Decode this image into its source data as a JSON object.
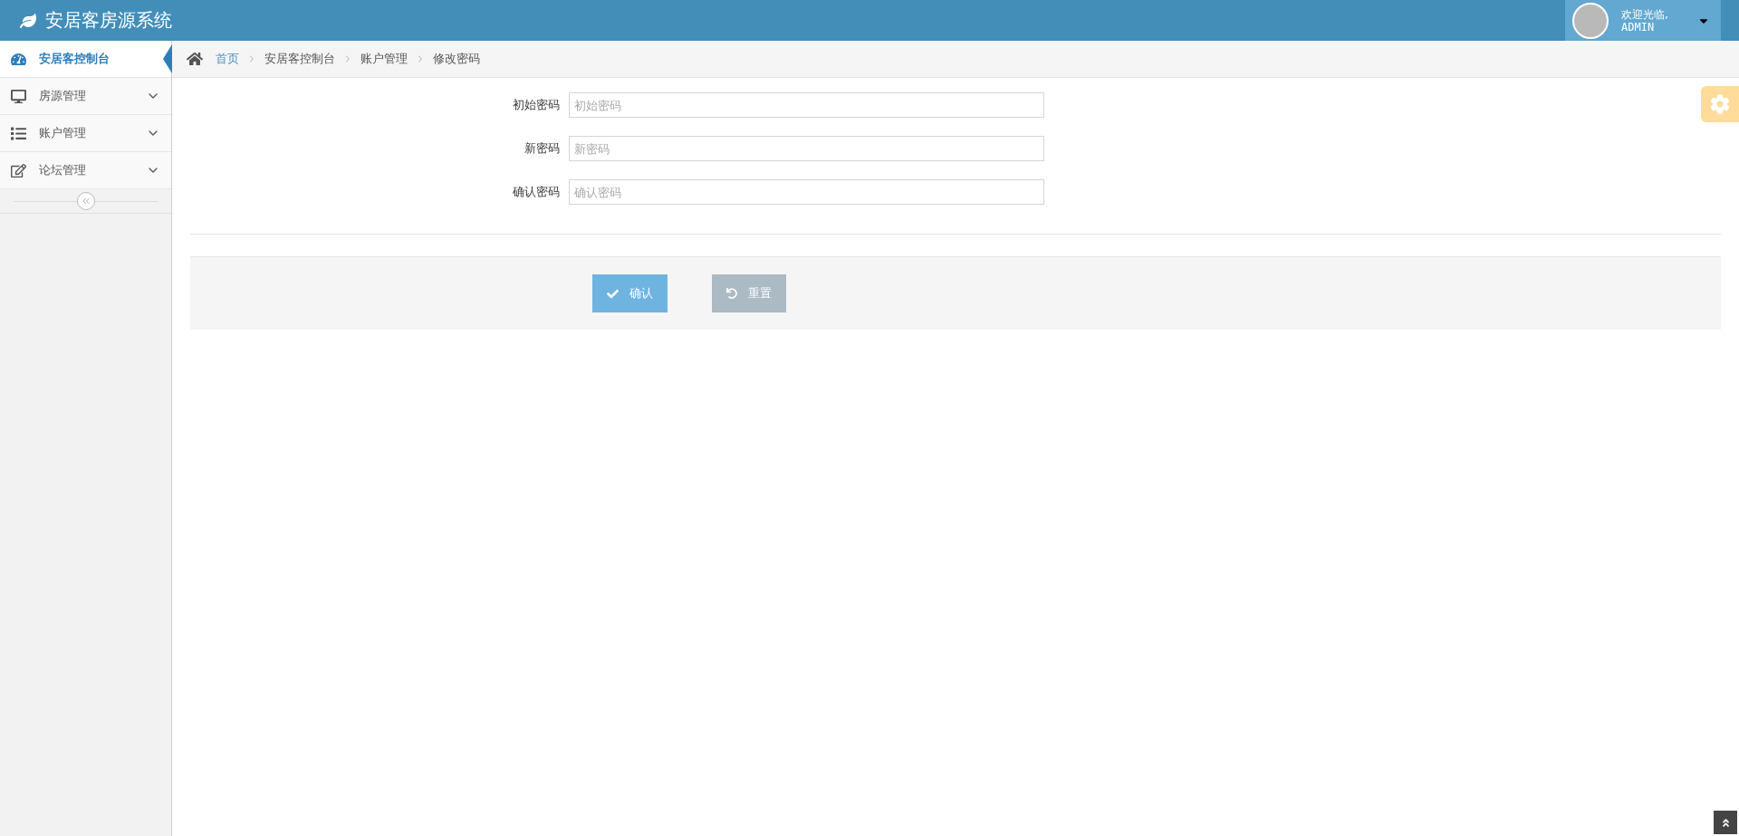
{
  "header": {
    "title": "安居客房源系统",
    "user": {
      "greeting": "欢迎光临,",
      "name": "ADMIN"
    }
  },
  "sidebar": {
    "items": [
      {
        "label": "安居客控制台",
        "selected": true,
        "expandable": false
      },
      {
        "label": "房源管理",
        "selected": false,
        "expandable": true
      },
      {
        "label": "账户管理",
        "selected": false,
        "expandable": true
      },
      {
        "label": "论坛管理",
        "selected": false,
        "expandable": true
      }
    ]
  },
  "breadcrumb": [
    {
      "label": "首页",
      "link": true
    },
    {
      "label": "安居客控制台",
      "link": false
    },
    {
      "label": "账户管理",
      "link": false
    },
    {
      "label": "修改密码",
      "link": false
    }
  ],
  "form": {
    "fields": [
      {
        "label": "初始密码",
        "placeholder": "初始密码"
      },
      {
        "label": "新密码",
        "placeholder": "新密码"
      },
      {
        "label": "确认密码",
        "placeholder": "确认密码"
      }
    ],
    "buttons": [
      {
        "label": "确认",
        "kind": "primary"
      },
      {
        "label": "重置",
        "kind": "reset"
      }
    ]
  }
}
